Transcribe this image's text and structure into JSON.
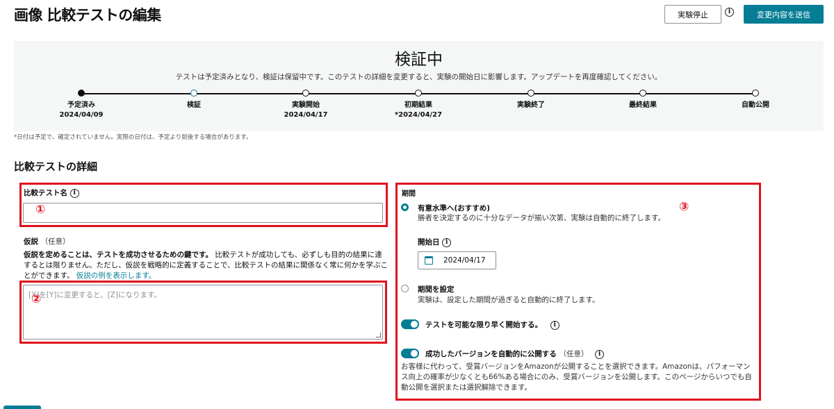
{
  "header": {
    "title": "画像 比較テストの編集",
    "stop_label": "実験停止",
    "info_icon": "info-icon",
    "submit_label": "変更内容を送信"
  },
  "status": {
    "title": "検証中",
    "message": "テストは予定済みとなり、検証は保留中です。このテストの詳細を変更すると、実験の開始日に影響します。アップデートを再度確認してください。",
    "steps": [
      {
        "label": "予定済み",
        "date": "2024/04/09",
        "state": "done"
      },
      {
        "label": "検証",
        "date": "",
        "state": "current"
      },
      {
        "label": "実験開始",
        "date": "2024/04/17",
        "state": "pending"
      },
      {
        "label": "初期結果",
        "date": "*2024/04/27",
        "state": "pending"
      },
      {
        "label": "実験終了",
        "date": "",
        "state": "pending"
      },
      {
        "label": "最終結果",
        "date": "",
        "state": "pending"
      },
      {
        "label": "自動公開",
        "date": "",
        "state": "pending"
      }
    ],
    "footnote": "*日付は予定で、確定されていません。実際の日付は、予定より前後する場合があります。"
  },
  "details": {
    "section_title": "比較テストの詳細",
    "test_name_label": "比較テスト名",
    "test_name_value": "",
    "hypothesis_label": "仮説",
    "hypothesis_optional": "（任意）",
    "hypothesis_bold": "仮説を定めることは、テストを成功させるための鍵です。",
    "hypothesis_text": "比較テストが成功しても、必ずしも目的の結果に達するとは限りません。ただし、仮説を戦略的に定義することで、比較テストの結果に関係なく常に何かを学ぶことができます。",
    "hypothesis_link": "仮説の例を表示します。",
    "hypothesis_placeholder": "[X]を[Y]に変更すると、[Z]になります。"
  },
  "duration": {
    "label": "期間",
    "option1_title": "有意水準へ(おすすめ)",
    "option1_desc": "勝者を決定するのに十分なデータが揃い次第、実験は自動的に終了します。",
    "start_label": "開始日",
    "start_date": "2024/04/17",
    "calendar_icon": "calendar-icon",
    "option2_title": "期間を設定",
    "option2_desc": "実験は、設定した期間が過ぎると自動的に終了します。",
    "toggle1_label": "テストを可能な限り早く開始する。",
    "toggle2_label": "成功したバージョンを自動的に公開する",
    "toggle2_optional": "（任意）",
    "publish_desc": "お客様に代わって、受賞バージョンをAmazonが公開することを選択できます。Amazonは、パフォーマンス向上の確率が少なくとも66%ある場合にのみ、受賞バージョンを公開します。このページからいつでも自動公開を選択または選択解除できます。"
  },
  "annotations": {
    "marker1": "①",
    "marker2": "②",
    "marker3": "③",
    "box_color": "#e0111f"
  },
  "colors": {
    "accent": "#047d95",
    "panel_bg": "#f5f6f6"
  }
}
